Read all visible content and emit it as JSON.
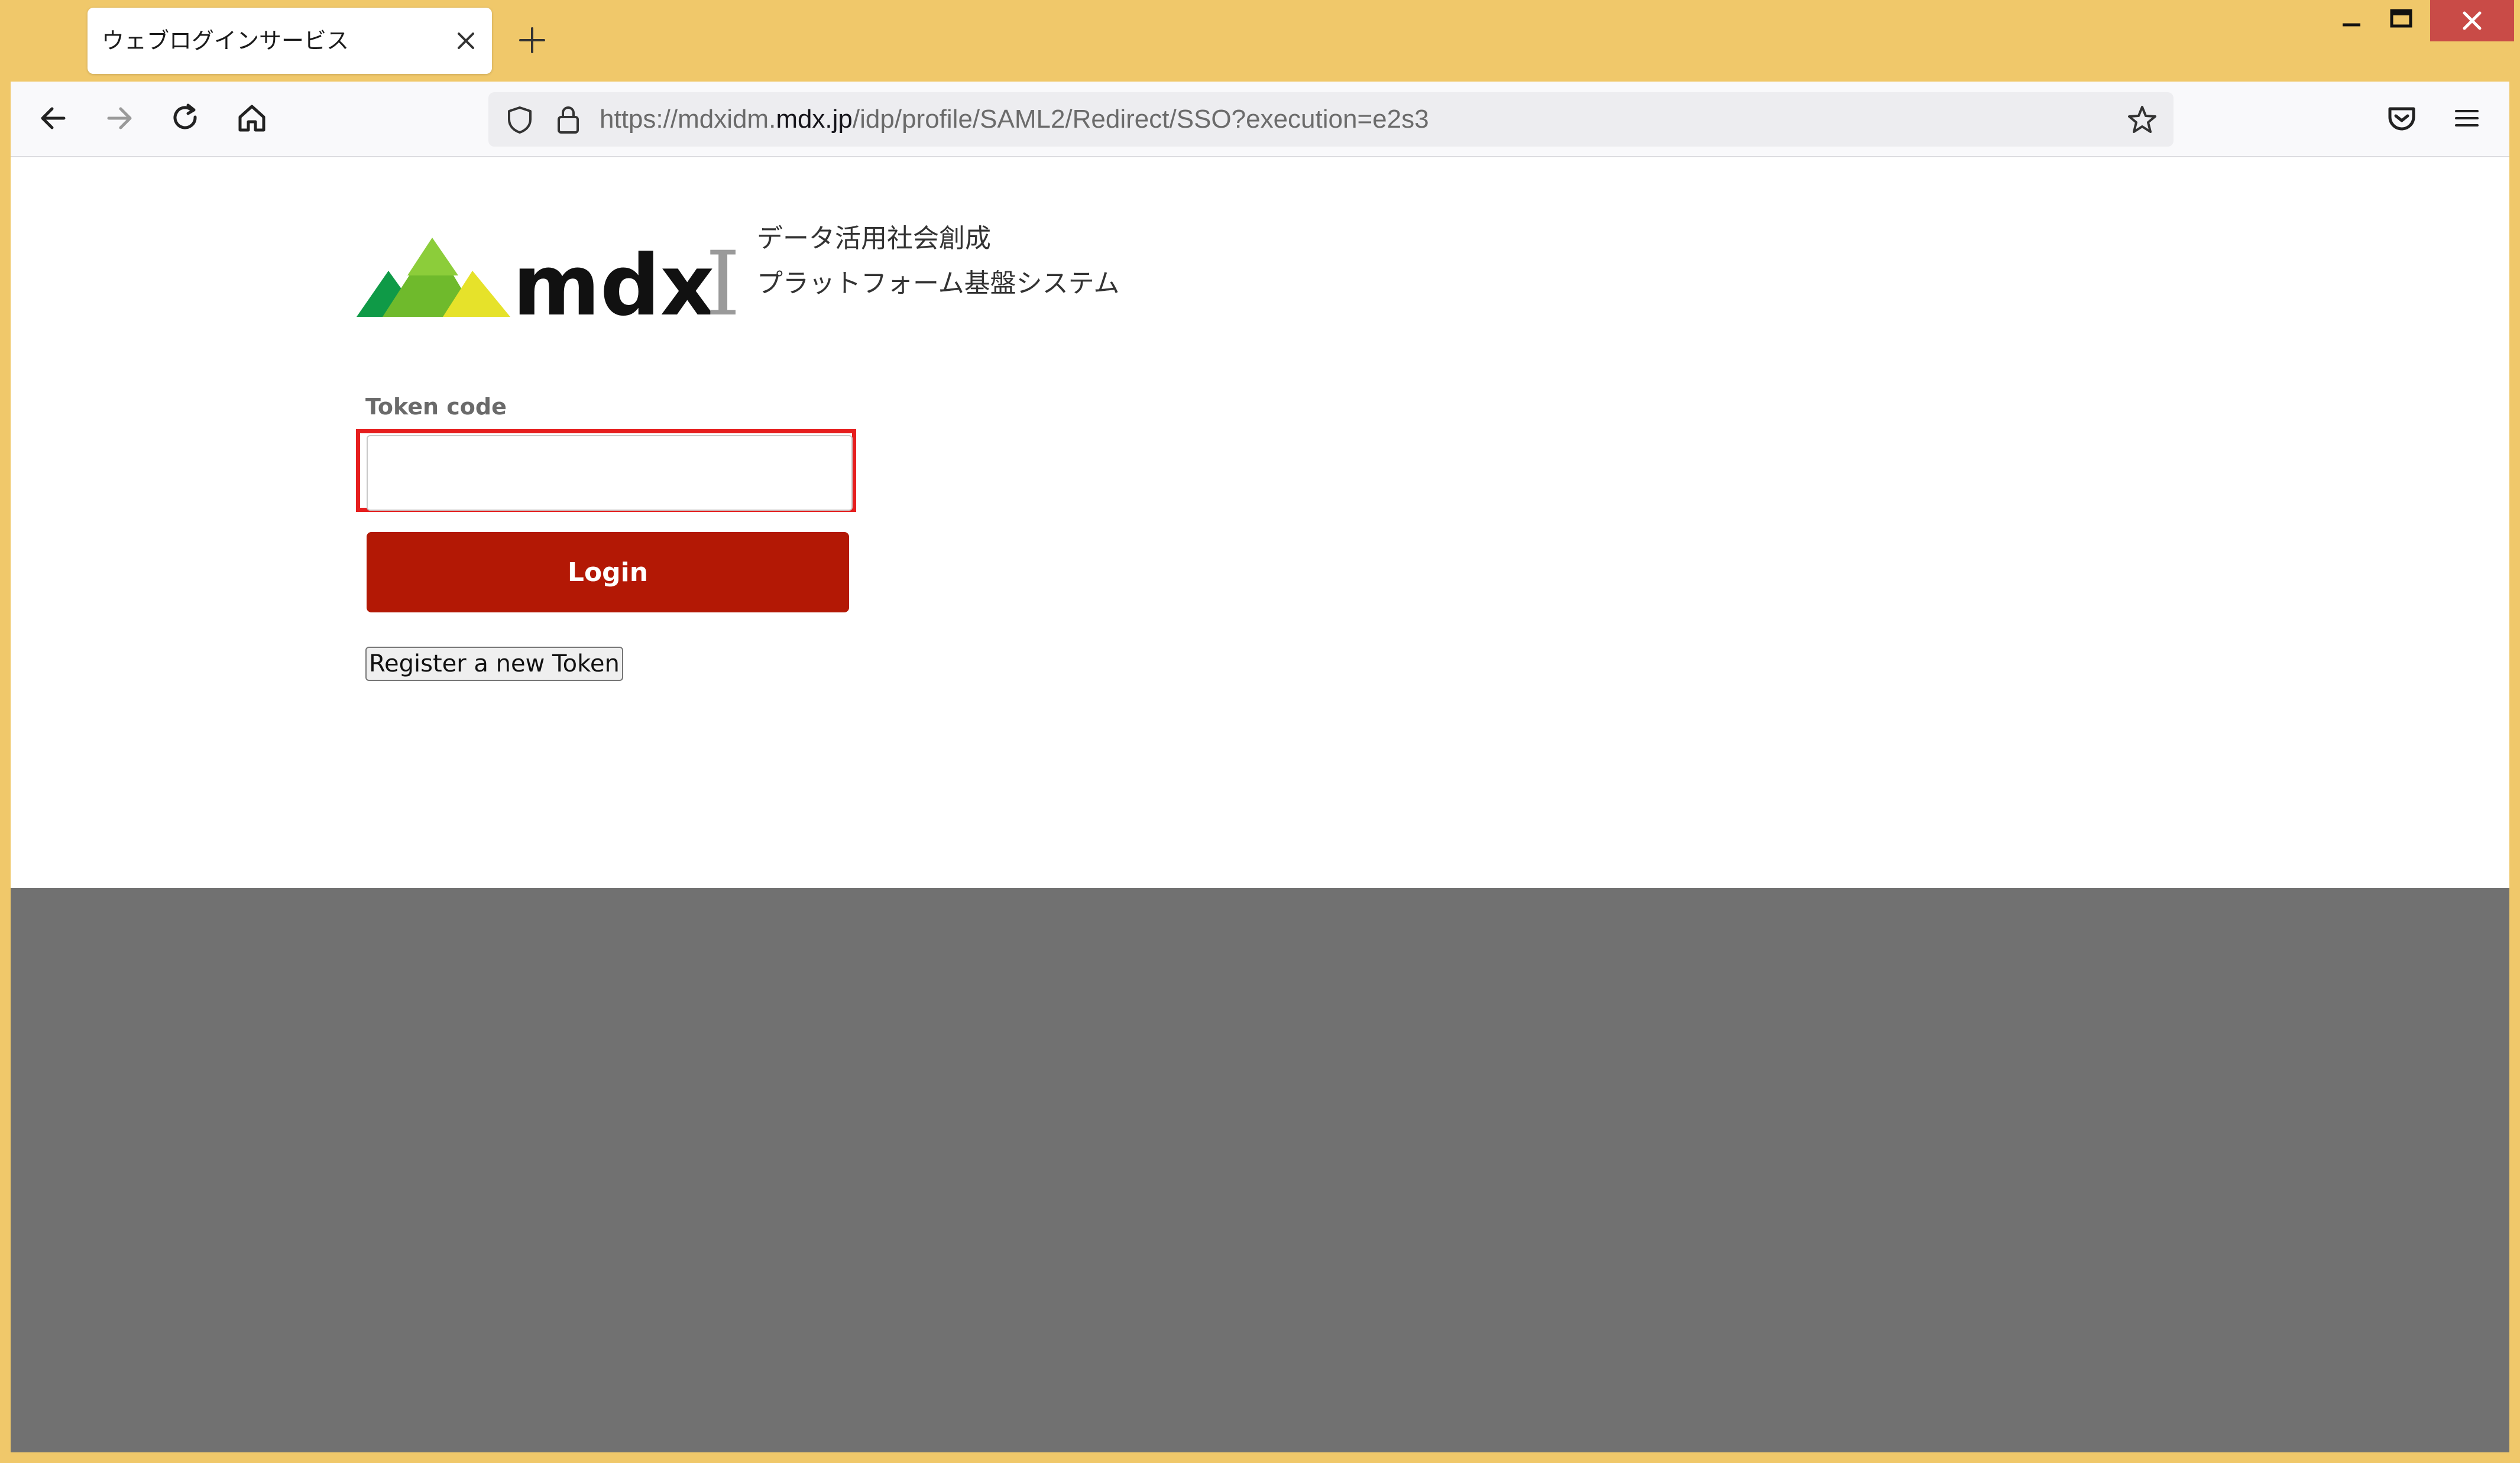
{
  "browser": {
    "tab_title": "ウェブログインサービス",
    "url_prefix": "https://mdxidm.",
    "url_host": "mdx.jp",
    "url_path": "/idp/profile/SAML2/Redirect/SSO?execution=e2s3"
  },
  "logo": {
    "wordmark": "mdx",
    "numeral": "I",
    "tagline_line1": "データ活用社会創成",
    "tagline_line2": "プラットフォーム基盤システム"
  },
  "form": {
    "token_label": "Token code",
    "token_value": "",
    "login_label": "Login",
    "register_label": "Register a new Token"
  },
  "colors": {
    "frame": "#f0c86a",
    "login_button": "#b31805",
    "highlight": "#e61e1e",
    "footer": "#717171",
    "logo_green_dark": "#0f9a47",
    "logo_green_light": "#6fba2c",
    "logo_yellow": "#e6e22a"
  },
  "icons": [
    "back-icon",
    "forward-icon",
    "reload-icon",
    "home-icon",
    "shield-icon",
    "lock-icon",
    "star-icon",
    "pocket-icon",
    "menu-icon",
    "close-icon",
    "plus-icon"
  ]
}
